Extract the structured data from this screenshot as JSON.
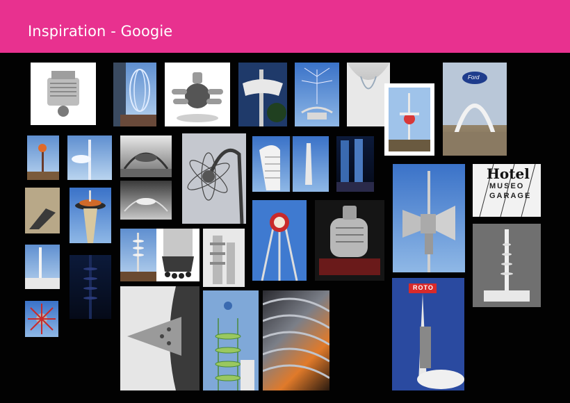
{
  "header": {
    "title": "Inspiration - Googie",
    "background_color": "#e8318f"
  },
  "board": {
    "background_color": "#020202",
    "tiles": [
      {
        "subject": "model engine",
        "style": "white"
      },
      {
        "subject": "tower with loop structure",
        "style": "sky"
      },
      {
        "subject": "chrome engine",
        "style": "white"
      },
      {
        "subject": "Googie roadside sign",
        "style": "dark"
      },
      {
        "subject": "atomic antenna building",
        "style": "sky2"
      },
      {
        "subject": "arched building interior",
        "style": "gray"
      },
      {
        "subject": "space age tower",
        "style": "card"
      },
      {
        "subject": "Ford rotunda arch",
        "style": "warm"
      },
      {
        "subject": "sign with star",
        "style": "sky"
      },
      {
        "subject": "spire tower",
        "style": "sky"
      },
      {
        "subject": "theme building",
        "style": "bw"
      },
      {
        "subject": "sputnik lamp",
        "style": "gray"
      },
      {
        "subject": "futuristic sign columns",
        "style": "sky2"
      },
      {
        "subject": "night towers",
        "style": "dark"
      },
      {
        "subject": "interior sculpture",
        "style": "warm"
      },
      {
        "subject": "space needle",
        "style": "sky2"
      },
      {
        "subject": "round drive in",
        "style": "bw2"
      },
      {
        "subject": "dish towers",
        "style": "sky"
      },
      {
        "subject": "rocket engine",
        "style": "white"
      },
      {
        "subject": "tiered tower",
        "style": "white"
      },
      {
        "subject": "Googie sign pole",
        "style": "sky2"
      },
      {
        "subject": "vintage mixer",
        "style": "dark"
      },
      {
        "subject": "siren tower",
        "style": "sky2"
      },
      {
        "subject": "Hotel Museo garage sign",
        "style": "bw"
      },
      {
        "subject": "streamline tower",
        "style": "bw2"
      },
      {
        "subject": "white spire",
        "style": "sky"
      },
      {
        "subject": "night spire",
        "style": "dark"
      },
      {
        "subject": "star object",
        "style": "sky2"
      },
      {
        "subject": "metal cone",
        "style": "white"
      },
      {
        "subject": "ring tower",
        "style": "sky"
      },
      {
        "subject": "metal waves",
        "style": "orange"
      },
      {
        "subject": "sign tower",
        "style": "sky2"
      }
    ]
  },
  "overlay_texts": {
    "ford_label": "Ford",
    "hotel_line1": "Hotel",
    "hotel_line2": "MUSEO",
    "hotel_line3": "GARAGE",
    "sign_label": "ROTO"
  }
}
